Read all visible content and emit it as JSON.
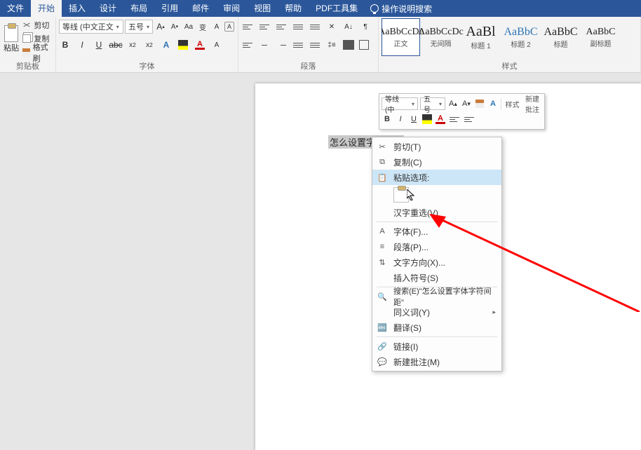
{
  "tabs": {
    "file": "文件",
    "home": "开始",
    "insert": "插入",
    "design": "设计",
    "layout": "布局",
    "references": "引用",
    "mailings": "邮件",
    "review": "审阅",
    "view": "视图",
    "help": "帮助",
    "pdf": "PDF工具集",
    "tell_me": "操作说明搜索"
  },
  "clipboard": {
    "paste": "粘贴",
    "cut": "剪切",
    "copy": "复制",
    "format_painter": "格式刷",
    "group_label": "剪贴板"
  },
  "font": {
    "name": "等线 (中文正文",
    "size": "五号",
    "group_label": "字体"
  },
  "paragraph": {
    "group_label": "段落"
  },
  "styles": {
    "group_label": "样式",
    "items": [
      {
        "preview": "AaBbCcDc",
        "name": "正文"
      },
      {
        "preview": "AaBbCcDc",
        "name": "无间隔"
      },
      {
        "preview": "AaBl",
        "name": "标题 1"
      },
      {
        "preview": "AaBbC",
        "name": "标题 2"
      },
      {
        "preview": "AaBbC",
        "name": "标题"
      },
      {
        "preview": "AaBbC",
        "name": "副标题"
      }
    ]
  },
  "document": {
    "selected_text": "怎么设置字体字符"
  },
  "mini_toolbar": {
    "font_name": "等线 (中",
    "font_size": "五号",
    "style": "样式",
    "new_comment": "新建\n批注"
  },
  "context_menu": {
    "cut": "剪切(T)",
    "copy": "复制(C)",
    "paste_options": "粘贴选项:",
    "han_reselect": "汉字重选(V)",
    "font": "字体(F)...",
    "paragraph": "段落(P)...",
    "text_direction": "文字方向(X)...",
    "insert_symbol": "插入符号(S)",
    "search": "搜索(E)\"怎么设置字体字符间距\"",
    "synonyms": "同义词(Y)",
    "translate": "翻译(S)",
    "link": "链接(I)",
    "new_comment": "新建批注(M)"
  }
}
